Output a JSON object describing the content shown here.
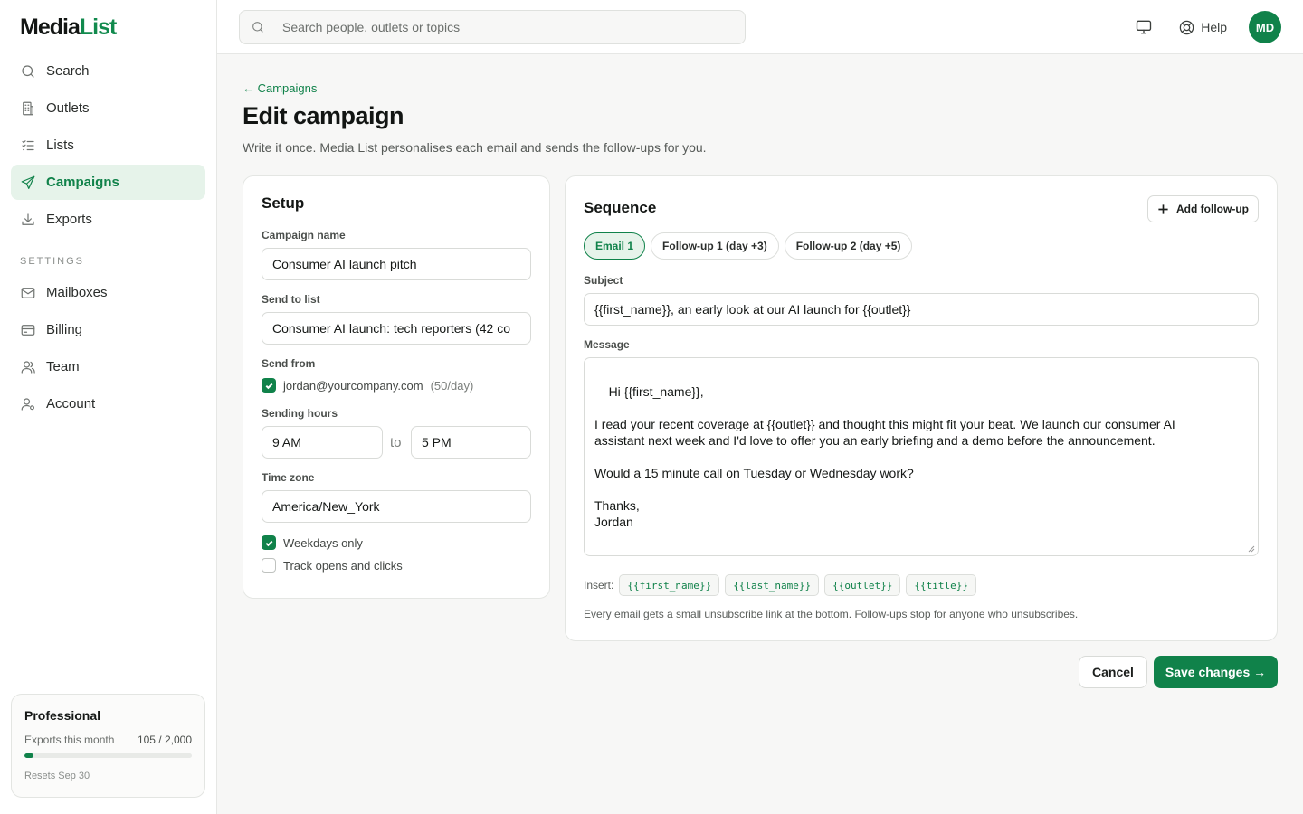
{
  "app": {
    "logo_main": "Media",
    "logo_accent": "List"
  },
  "sidebar": {
    "items": [
      {
        "label": "Search",
        "icon": "search-icon"
      },
      {
        "label": "Outlets",
        "icon": "building-icon"
      },
      {
        "label": "Lists",
        "icon": "list-icon"
      },
      {
        "label": "Campaigns",
        "icon": "send-icon",
        "active": true
      },
      {
        "label": "Exports",
        "icon": "download-icon"
      }
    ],
    "settings_label": "SETTINGS",
    "settings_items": [
      {
        "label": "Mailboxes",
        "icon": "mail-icon"
      },
      {
        "label": "Billing",
        "icon": "credit-card-icon"
      },
      {
        "label": "Team",
        "icon": "users-icon"
      },
      {
        "label": "Account",
        "icon": "user-cog-icon"
      }
    ],
    "plan": {
      "name": "Professional",
      "usage_label": "Exports this month",
      "usage_count": "105 / 2,000",
      "usage_fraction": 0.0525,
      "reset": "Resets Sep 30"
    }
  },
  "topbar": {
    "search_placeholder": "Search people, outlets or topics",
    "help_label": "Help",
    "avatar_initials": "MD"
  },
  "page": {
    "back_link": "← Campaigns",
    "title": "Edit campaign",
    "subtitle": "Write it once. Media List personalises each email and sends the follow-ups for you."
  },
  "setup": {
    "title": "Setup",
    "campaign_name_label": "Campaign name",
    "campaign_name": "Consumer AI launch pitch",
    "send_to_label": "Send to list",
    "send_to": "Consumer AI launch: tech reporters (42 co",
    "send_from_label": "Send from",
    "send_from_email": "jordan@yourcompany.com",
    "send_from_limit": "(50/day)",
    "hours_label": "Sending hours",
    "hours_from": "9 AM",
    "hours_to_word": "to",
    "hours_to": "5 PM",
    "timezone_label": "Time zone",
    "timezone": "America/New_York",
    "weekdays_label": "Weekdays only",
    "weekdays_checked": true,
    "track_label": "Track opens and clicks",
    "track_checked": false
  },
  "sequence": {
    "title": "Sequence",
    "add_label": "Add follow-up",
    "tabs": [
      "Email 1",
      "Follow-up 1 (day +3)",
      "Follow-up 2 (day +5)"
    ],
    "subject_label": "Subject",
    "subject": "{{first_name}}, an early look at our AI launch for {{outlet}}",
    "message_label": "Message",
    "message": "Hi {{first_name}},\n\nI read your recent coverage at {{outlet}} and thought this might fit your beat. We launch our consumer AI\nassistant next week and I'd love to offer you an early briefing and a demo before the announcement.\n\nWould a 15 minute call on Tuesday or Wednesday work?\n\nThanks,\nJordan",
    "insert_label": "Insert:",
    "chips": [
      "{{first_name}}",
      "{{last_name}}",
      "{{outlet}}",
      "{{title}}"
    ],
    "footnote": "Every email gets a small unsubscribe link at the bottom. Follow-ups stop for anyone who unsubscribes."
  },
  "actions": {
    "cancel": "Cancel",
    "save": "Save changes →"
  },
  "colors": {
    "accent": "#10824a",
    "accent_light": "#e6f3ea"
  }
}
